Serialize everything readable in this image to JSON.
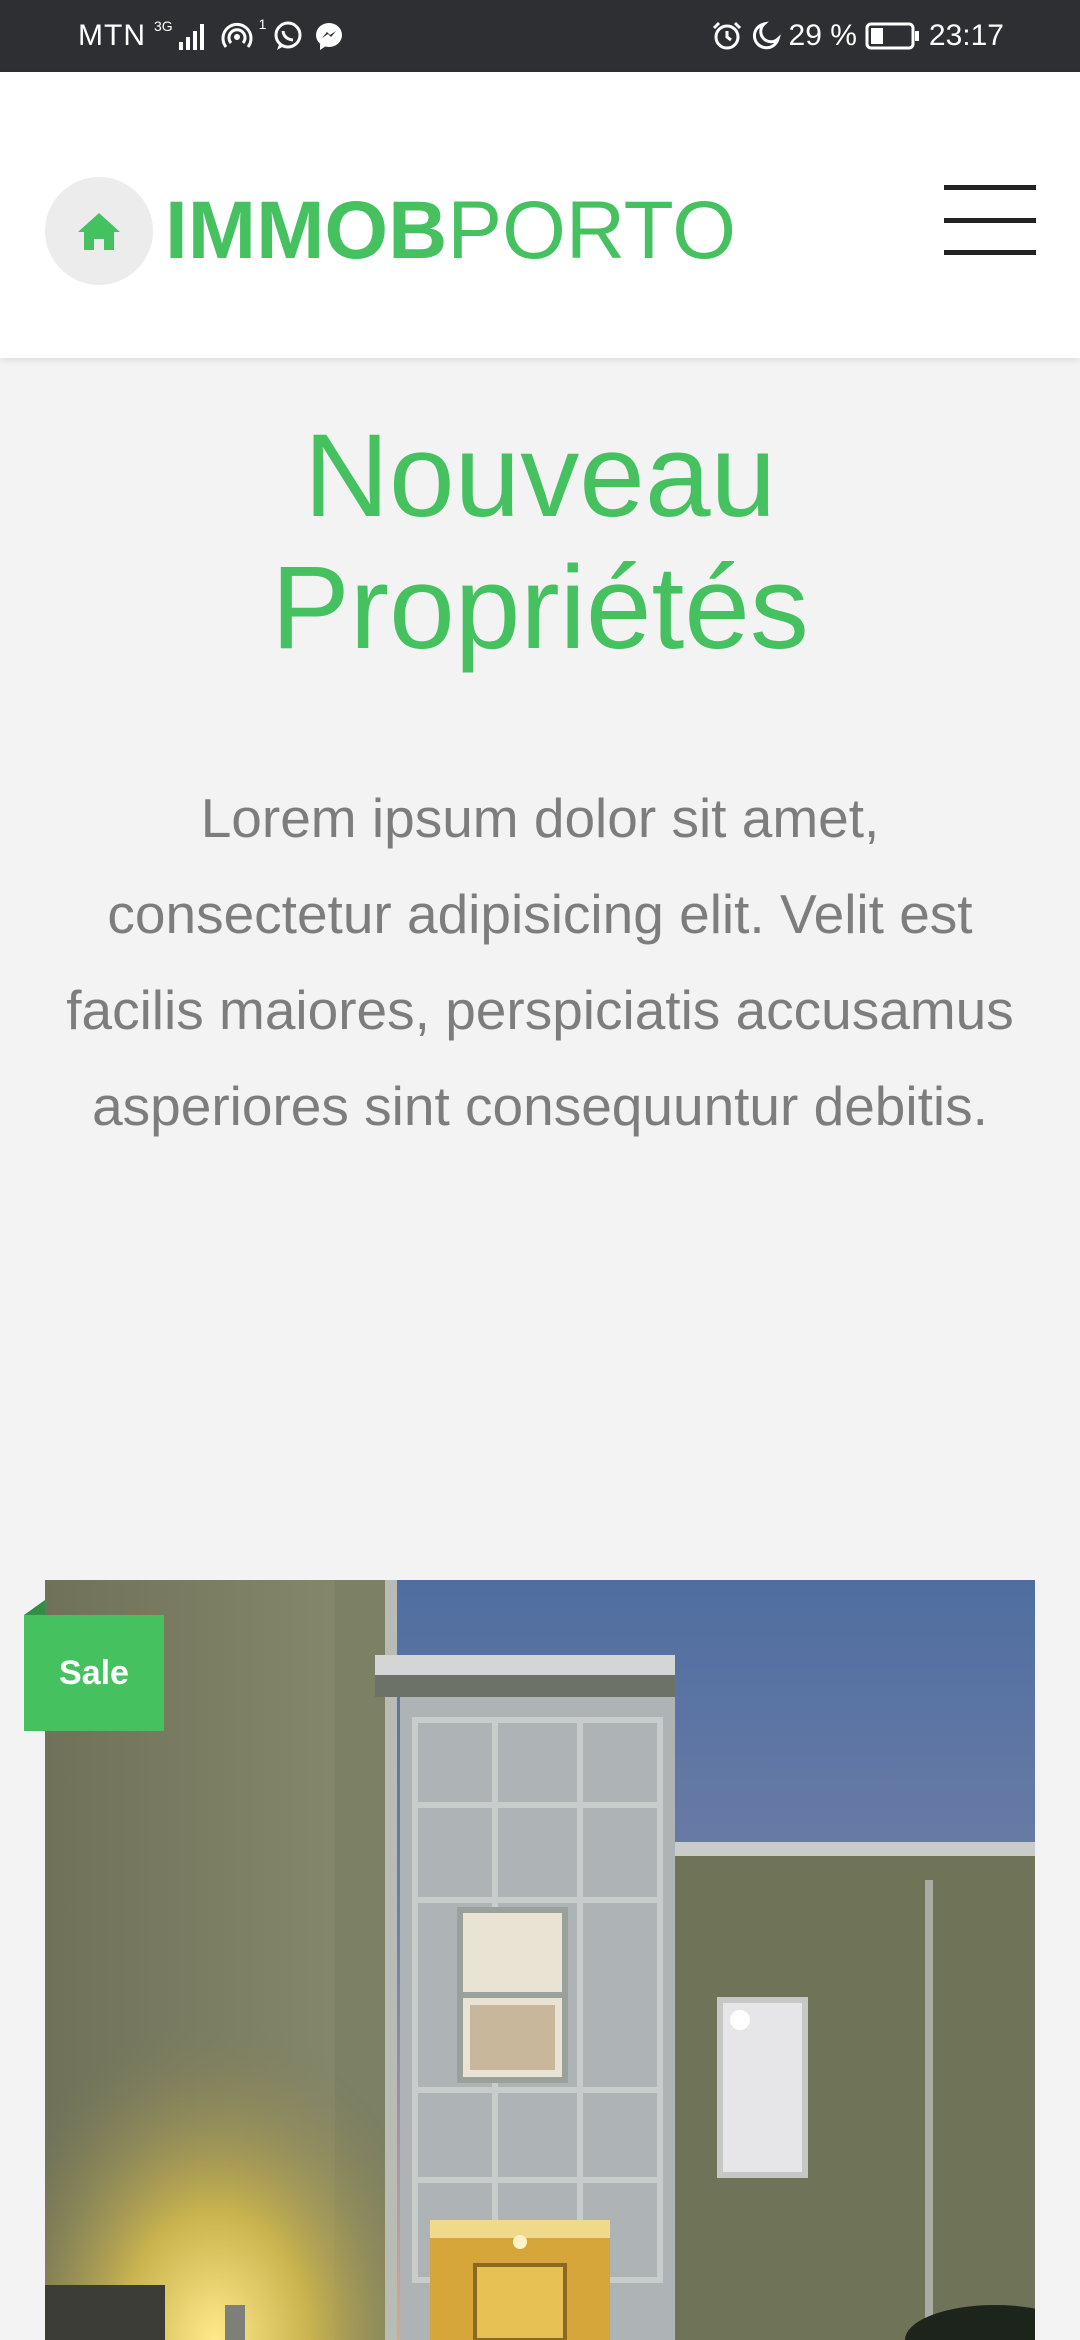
{
  "status_bar": {
    "carrier": "MTN",
    "network": "3G",
    "sim": "1",
    "battery": "29 %",
    "time": "23:17"
  },
  "header": {
    "logo_bold": "IMMOB",
    "logo_light": "PORTO"
  },
  "hero": {
    "title_line1": "Nouveau",
    "title_line2": "Propriétés",
    "intro": "Lorem ipsum dolor sit amet, consectetur adipisicing elit. Velit est facilis maiores, perspiciatis accusamus asperiores sint consequuntur debitis."
  },
  "property": {
    "badge": "Sale"
  },
  "colors": {
    "accent": "#45c160",
    "status_bar": "#2e2f33",
    "background": "#f3f3f3",
    "body_text": "#7d7d7d"
  },
  "icons": {
    "logo": "home-icon",
    "menu": "hamburger-menu-icon"
  }
}
